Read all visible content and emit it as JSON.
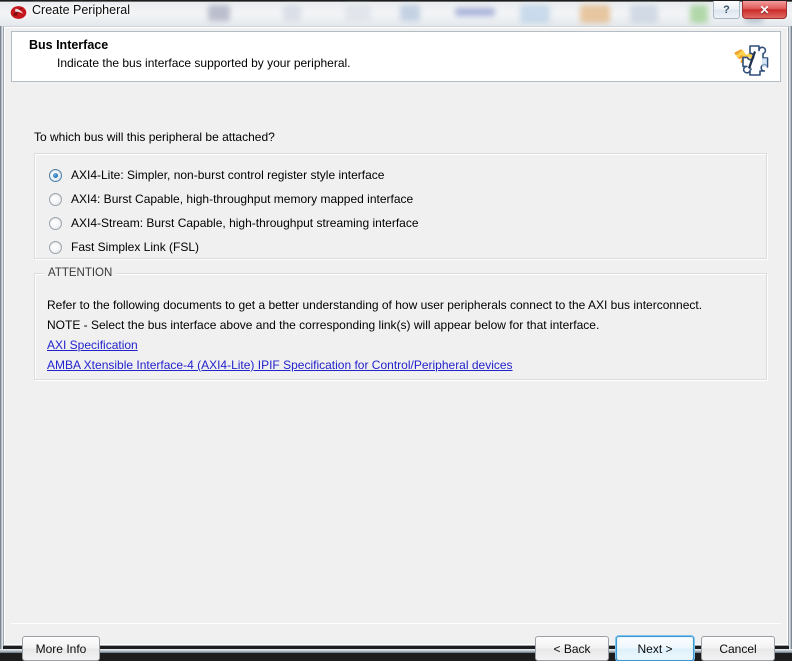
{
  "window": {
    "title": "Create Peripheral",
    "app_icon": "xilinx-logo-icon",
    "help_button_label": "?",
    "close_button_label": "✕"
  },
  "header": {
    "title": "Bus Interface",
    "subtitle": "Indicate the bus interface supported by your peripheral.",
    "icon": "puzzle-piece-icon"
  },
  "main": {
    "question": "To which bus will this peripheral be attached?",
    "bus_options": [
      {
        "label": "AXI4-Lite: Simpler, non-burst control register style interface",
        "checked": true
      },
      {
        "label": "AXI4: Burst Capable, high-throughput memory mapped interface",
        "checked": false
      },
      {
        "label": "AXI4-Stream: Burst Capable, high-throughput streaming interface",
        "checked": false
      },
      {
        "label": "Fast Simplex Link (FSL)",
        "checked": false
      }
    ],
    "attention": {
      "legend": "ATTENTION",
      "line1": "Refer to the following documents to get a better understanding of how user peripherals connect to the AXI bus interconnect.",
      "line2": "NOTE - Select the bus interface above and the corresponding link(s) will appear below for that interface.",
      "links": [
        "AXI Specification",
        "AMBA Xtensible Interface-4 (AXI4-Lite) IPIF Specification for Control/Peripheral devices"
      ]
    }
  },
  "footer": {
    "more_info": "More Info",
    "back": "< Back",
    "next": "Next >",
    "cancel": "Cancel"
  },
  "colors": {
    "body_bg": "#f0f0f0",
    "header_bg": "#ffffff",
    "link": "#2222cc",
    "accent_focus": "#3c99d4",
    "close_red": "#cc2b2b"
  }
}
